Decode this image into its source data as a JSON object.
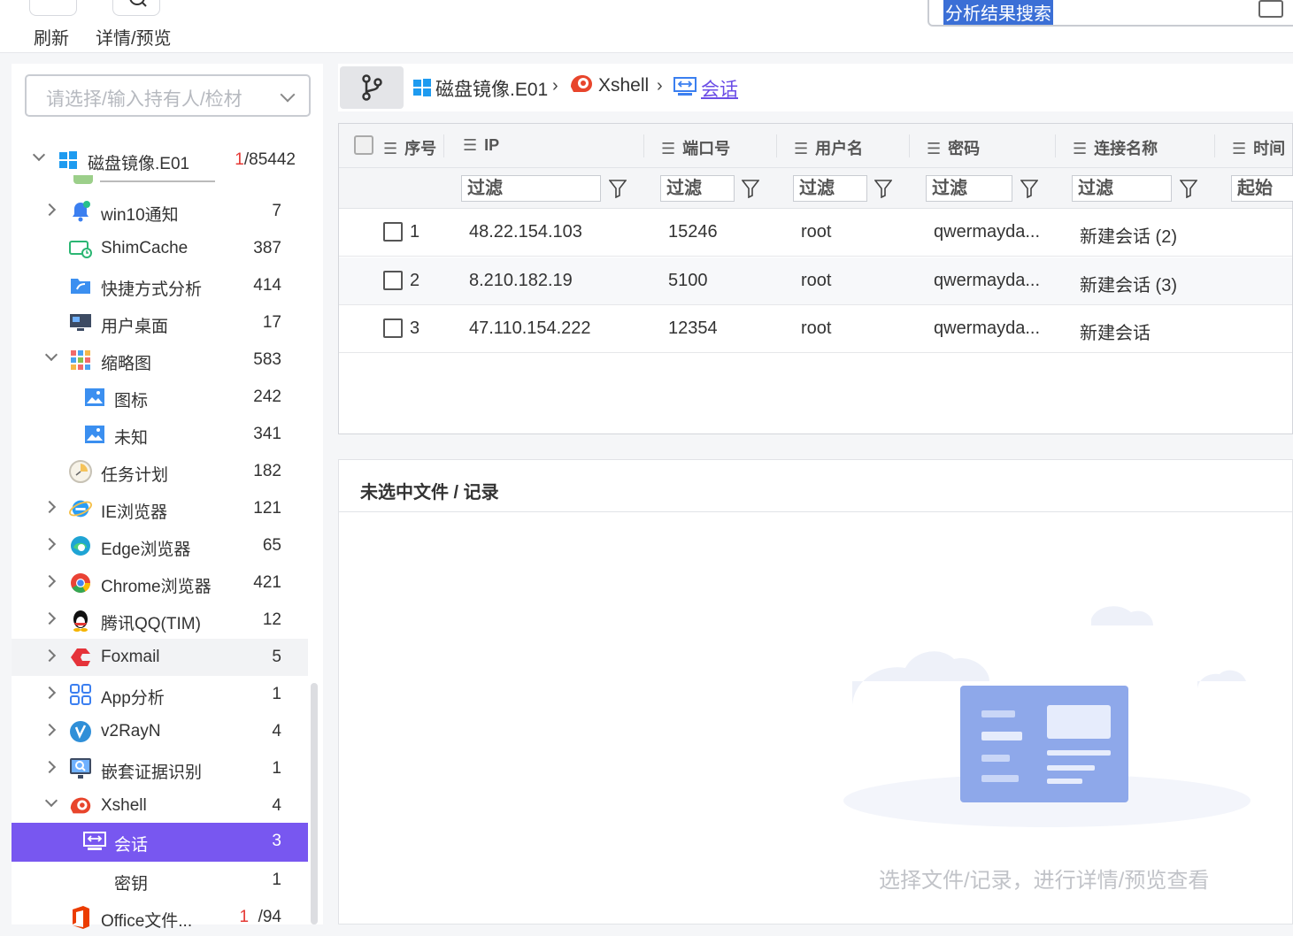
{
  "toolbar": {
    "refresh_label": "刷新",
    "detail_label": "详情/预览",
    "search_text": "分析结果搜索"
  },
  "left": {
    "owner_placeholder": "请选择/输入持有人/检材",
    "tree": [
      {
        "label": "磁盘镜像.E01",
        "count_red": "1",
        "count": "/85442"
      },
      {
        "label": "win10通知",
        "count": "7"
      },
      {
        "label": "ShimCache",
        "count": "387"
      },
      {
        "label": "快捷方式分析",
        "count": "414"
      },
      {
        "label": "用户桌面",
        "count": "17"
      },
      {
        "label": "缩略图",
        "count": "583"
      },
      {
        "label": "图标",
        "count": "242"
      },
      {
        "label": "未知",
        "count": "341"
      },
      {
        "label": "任务计划",
        "count": "182"
      },
      {
        "label": "IE浏览器",
        "count": "121"
      },
      {
        "label": "Edge浏览器",
        "count": "65"
      },
      {
        "label": "Chrome浏览器",
        "count": "421"
      },
      {
        "label": "腾讯QQ(TIM)",
        "count": "12"
      },
      {
        "label": "Foxmail",
        "count": "5"
      },
      {
        "label": "App分析",
        "count": "1"
      },
      {
        "label": "v2RayN",
        "count": "4"
      },
      {
        "label": "嵌套证据识别",
        "count": "1"
      },
      {
        "label": "Xshell",
        "count": "4"
      },
      {
        "label": "会话",
        "count": "3"
      },
      {
        "label": "密钥",
        "count": "1"
      },
      {
        "label": "Office文件...",
        "count_red": "1",
        "count": "/94"
      }
    ]
  },
  "breadcrumb": {
    "root": "磁盘镜像.E01",
    "app": "Xshell",
    "current": "会话"
  },
  "grid": {
    "columns": [
      "序号",
      "IP",
      "端口号",
      "用户名",
      "密码",
      "连接名称",
      "时间"
    ],
    "filter_placeholder": "过滤",
    "time_filter_placeholder": "起始",
    "rows": [
      {
        "index": "1",
        "ip": "48.22.154.103",
        "port": "15246",
        "user": "root",
        "password": "qwermayda...",
        "name": "新建会话 (2)"
      },
      {
        "index": "2",
        "ip": "8.210.182.19",
        "port": "5100",
        "user": "root",
        "password": "qwermayda...",
        "name": "新建会话 (3)"
      },
      {
        "index": "3",
        "ip": "47.110.154.222",
        "port": "12354",
        "user": "root",
        "password": "qwermayda...",
        "name": "新建会话"
      }
    ]
  },
  "preview": {
    "title": "未选中文件 / 记录",
    "empty_text": "选择文件/记录，进行详情/预览查看"
  },
  "colors": {
    "accent": "#7857f0",
    "count_red": "#e53935",
    "link": "#6b4de6"
  }
}
